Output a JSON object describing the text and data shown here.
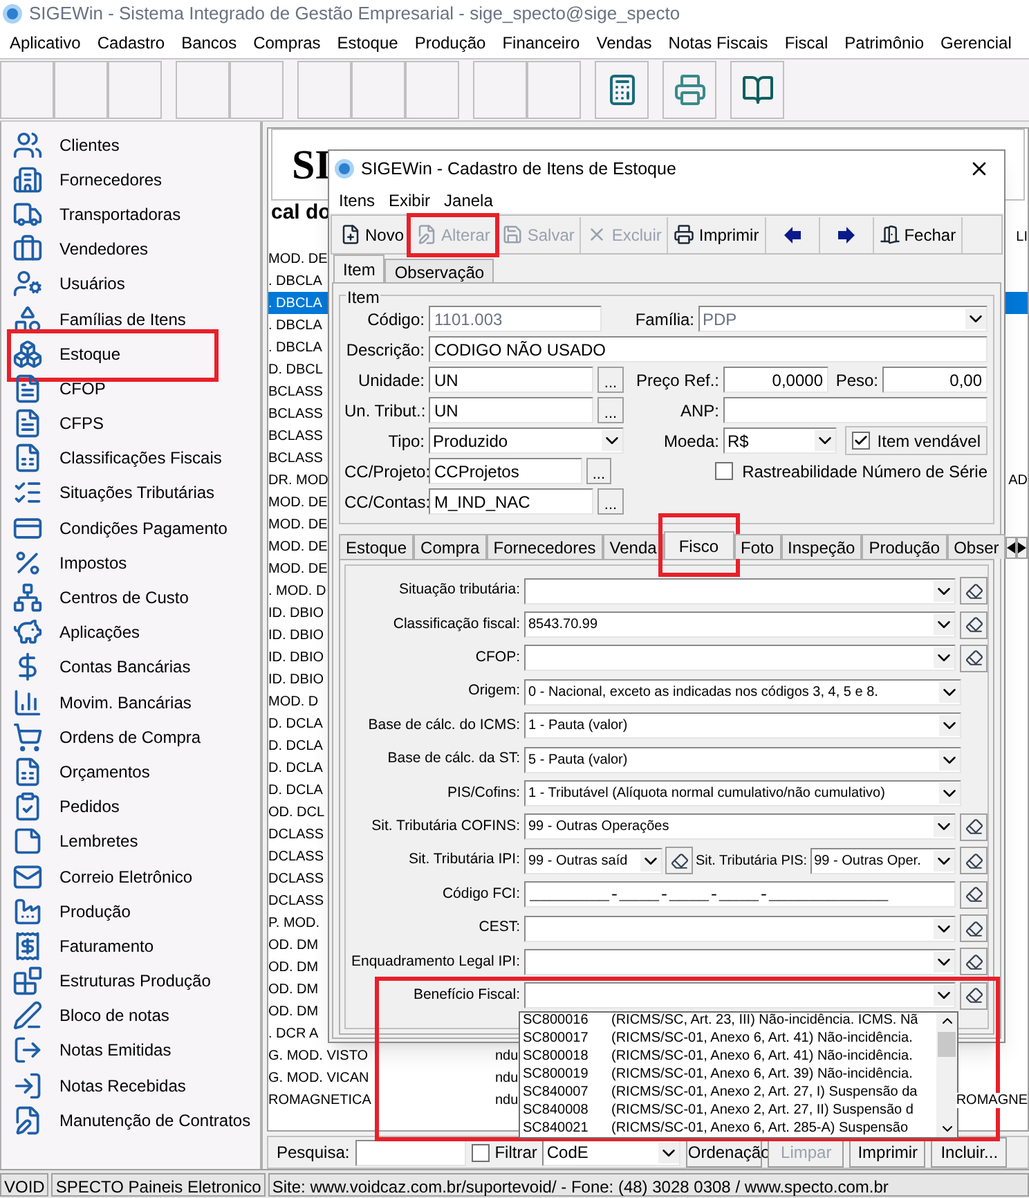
{
  "window": {
    "title": "SIGEWin - Sistema Integrado de Gestão Empresarial - sige_specto@sige_specto"
  },
  "menu": [
    "Aplicativo",
    "Cadastro",
    "Bancos",
    "Compras",
    "Estoque",
    "Produção",
    "Financeiro",
    "Vendas",
    "Notas Fiscais",
    "Fiscal",
    "Patrimônio",
    "Gerencial"
  ],
  "toolbar_groups": [
    [
      {
        "kind": "blank"
      },
      {
        "kind": "blank"
      },
      {
        "kind": "blank"
      }
    ],
    [
      {
        "kind": "blank"
      },
      {
        "kind": "blank"
      }
    ],
    [
      {
        "kind": "blank"
      },
      {
        "kind": "blank"
      },
      {
        "kind": "blank"
      }
    ],
    [
      {
        "kind": "blank"
      },
      {
        "kind": "blank"
      }
    ],
    [
      {
        "kind": "calculator"
      }
    ],
    [
      {
        "kind": "printer"
      }
    ],
    [
      {
        "kind": "book"
      }
    ]
  ],
  "sidebar": {
    "items": [
      {
        "label": "Clientes",
        "highlighted": false
      },
      {
        "label": "Fornecedores",
        "highlighted": false
      },
      {
        "label": "Transportadoras",
        "highlighted": false
      },
      {
        "label": "Vendedores",
        "highlighted": false
      },
      {
        "label": "Usuários",
        "highlighted": false
      },
      {
        "label": "Famílias de Itens",
        "highlighted": false
      },
      {
        "label": "Estoque",
        "highlighted": true
      },
      {
        "label": "CFOP",
        "highlighted": false
      },
      {
        "label": "CFPS",
        "highlighted": false
      },
      {
        "label": "Classificações Fiscais",
        "highlighted": false
      },
      {
        "label": "Situações Tributárias",
        "highlighted": false
      },
      {
        "label": "Condições Pagamento",
        "highlighted": false
      },
      {
        "label": "Impostos",
        "highlighted": false
      },
      {
        "label": "Centros de Custo",
        "highlighted": false
      },
      {
        "label": "Aplicações",
        "highlighted": false
      },
      {
        "label": "Contas Bancárias",
        "highlighted": false
      },
      {
        "label": "Movim. Bancárias",
        "highlighted": false
      },
      {
        "label": "Ordens de Compra",
        "highlighted": false
      },
      {
        "label": "Orçamentos",
        "highlighted": false
      },
      {
        "label": "Pedidos",
        "highlighted": false
      },
      {
        "label": "Lembretes",
        "highlighted": false
      },
      {
        "label": "Correio Eletrônico",
        "highlighted": false
      },
      {
        "label": "Produção",
        "highlighted": false
      },
      {
        "label": "Faturamento",
        "highlighted": false
      },
      {
        "label": "Estruturas Produção",
        "highlighted": false
      },
      {
        "label": "Bloco de notas",
        "highlighted": false
      },
      {
        "label": "Notas Emitidas",
        "highlighted": false
      },
      {
        "label": "Notas Recebidas",
        "highlighted": false
      },
      {
        "label": "Manutenção de Contratos",
        "highlighted": false
      }
    ]
  },
  "list": {
    "banner": "SI",
    "heading": "cal do",
    "rows": [
      {
        "right": "LI",
        "selected": false
      },
      {
        "text": "MOD. DE",
        "selected": false
      },
      {
        "text": ". DBCLA",
        "selected": false
      },
      {
        "text": ". DBCLA",
        "selected": true
      },
      {
        "text": ". DBCLA",
        "selected": false
      },
      {
        "text": ". DBCLA",
        "selected": false
      },
      {
        "text": "D. DBCL",
        "selected": false
      },
      {
        "text": "BCLASS",
        "selected": false
      },
      {
        "text": "BCLASS",
        "selected": false
      },
      {
        "text": "BCLASS",
        "selected": false
      },
      {
        "text": "BCLASS",
        "selected": false
      },
      {
        "text": "DR. MOD",
        "right": "AD",
        "selected": false
      },
      {
        "text": "MOD. DE",
        "selected": false
      },
      {
        "text": "MOD. DE",
        "selected": false
      },
      {
        "text": "MOD. DE",
        "selected": false
      },
      {
        "text": "MOD. DE",
        "selected": false
      },
      {
        "text": ". MOD. D",
        "selected": false
      },
      {
        "text": "ID. DBIO",
        "selected": false
      },
      {
        "text": "ID. DBIO",
        "selected": false
      },
      {
        "text": "ID. DBIO",
        "selected": false
      },
      {
        "text": "ID. DBIO",
        "selected": false
      },
      {
        "text": "MOD. D",
        "selected": false
      },
      {
        "text": "D. DCLA",
        "selected": false
      },
      {
        "text": "D. DCLA",
        "selected": false
      },
      {
        "text": "D. DCLA",
        "selected": false
      },
      {
        "text": "D. DCLA",
        "selected": false
      },
      {
        "text": "OD. DCL",
        "selected": false
      },
      {
        "text": "DCLASS",
        "selected": false
      },
      {
        "text": "DCLASS",
        "selected": false
      },
      {
        "text": "DCLASS",
        "selected": false
      },
      {
        "text": "DCLASS",
        "selected": false
      },
      {
        "text": "P. MOD.",
        "selected": false
      },
      {
        "text": "OD. DM",
        "selected": false
      },
      {
        "text": "OD. DM",
        "selected": false
      },
      {
        "text": "OD. DM",
        "selected": false
      },
      {
        "text": "OD. DM",
        "selected": false
      },
      {
        "text": ". DCR A",
        "selected": false
      },
      {
        "text": "G. MOD. VISTO",
        "middle": "ndu",
        "selected": false
      },
      {
        "text": "G. MOD. VICAN",
        "middle": "ndu",
        "selected": false
      },
      {
        "text": "ROMAGNETICA",
        "middle": "ndu",
        "right": "ROMAGNE",
        "selected": false
      }
    ]
  },
  "search_bar": {
    "label": "Pesquisa:",
    "filter": {
      "label": "Filtrar",
      "checked": false
    },
    "order_field": "CodE",
    "buttons": [
      {
        "label": "Ordenação",
        "disabled": false
      },
      {
        "label": "Limpar",
        "disabled": true
      },
      {
        "label": "Imprimir",
        "disabled": false
      },
      {
        "label": "Incluir...",
        "disabled": false
      }
    ]
  },
  "status_bar": [
    "VOID",
    "SPECTO Paineis Eletronico",
    "Site: www.voidcaz.com.br/suportevoid/  -  Fone: (48) 3028 0308 / www.specto.com.br"
  ],
  "dialog": {
    "title": "SIGEWin - Cadastro de Itens de Estoque",
    "menu": [
      "Itens",
      "Exibir",
      "Janela"
    ],
    "toolbar": [
      {
        "kind": "new",
        "label": "Novo",
        "disabled": false,
        "highlighted": false
      },
      {
        "kind": "edit",
        "label": "Alterar",
        "disabled": true,
        "highlighted": true
      },
      {
        "kind": "save",
        "label": "Salvar",
        "disabled": true,
        "highlighted": false
      },
      {
        "kind": "delete",
        "label": "Excluir",
        "disabled": true,
        "highlighted": false
      },
      {
        "kind": "print",
        "label": "Imprimir",
        "disabled": false,
        "highlighted": false
      },
      {
        "kind": "prev",
        "disabled": false,
        "highlighted": false
      },
      {
        "kind": "next",
        "disabled": false,
        "highlighted": false
      },
      {
        "kind": "close",
        "label": "Fechar",
        "disabled": false,
        "highlighted": false
      }
    ],
    "tabs": [
      {
        "label": "Item",
        "selected": true
      },
      {
        "label": "Observação",
        "selected": false
      }
    ],
    "item_group": {
      "title": "Item",
      "codigo": {
        "label": "Código:",
        "value": "1101.003",
        "disabled": true
      },
      "familia": {
        "label": "Família:",
        "value": "PDP",
        "disabled": true
      },
      "descricao": {
        "label": "Descrição:",
        "value": "CODIGO NÃO USADO"
      },
      "unidade": {
        "label": "Unidade:",
        "value": "UN"
      },
      "preco": {
        "label": "Preço Ref.:",
        "value": "0,0000"
      },
      "peso": {
        "label": "Peso:",
        "value": "0,00"
      },
      "un_tribut": {
        "label": "Un. Tribut.:",
        "value": "UN"
      },
      "anp": {
        "label": "ANP:"
      },
      "tipo": {
        "label": "Tipo:",
        "value": "Produzido"
      },
      "moeda": {
        "label": "Moeda:",
        "value": "R$"
      },
      "vendavel": {
        "label": "Item vendável",
        "checked": true
      },
      "cc_projeto": {
        "label": "CC/Projeto:",
        "value": "CCProjetos"
      },
      "rastreabilidade": {
        "label": "Rastreabilidade Número de Série",
        "checked": false
      },
      "cc_contas": {
        "label": "CC/Contas:",
        "value": "M_IND_NAC"
      },
      "browse": "..."
    },
    "detail_tabs": [
      {
        "label": "Estoque",
        "selected": false,
        "highlighted": false
      },
      {
        "label": "Compra",
        "selected": false,
        "highlighted": false
      },
      {
        "label": "Fornecedores",
        "selected": false,
        "highlighted": false
      },
      {
        "label": "Venda",
        "selected": false,
        "highlighted": false
      },
      {
        "label": "Fisco",
        "selected": true,
        "highlighted": true
      },
      {
        "label": "Foto",
        "selected": false,
        "highlighted": false
      },
      {
        "label": "Inspeção",
        "selected": false,
        "highlighted": false
      },
      {
        "label": "Produção",
        "selected": false,
        "highlighted": false
      },
      {
        "label": "Obser",
        "selected": false,
        "highlighted": false
      }
    ],
    "fisco": {
      "rows": [
        {
          "kind": "combo",
          "label": "Situação tributária:",
          "clear_button": true,
          "highlighted": false
        },
        {
          "kind": "combo",
          "label": "Classificação fiscal:",
          "value": "8543.70.99",
          "clear_button": true,
          "highlighted": false
        },
        {
          "kind": "combo",
          "label": "CFOP:",
          "clear_button": true,
          "highlighted": false
        },
        {
          "kind": "combo",
          "label": "Origem:",
          "value": "0 - Nacional, exceto as indicadas nos códigos 3, 4, 5 e 8.",
          "clear_button": false,
          "highlighted": false
        },
        {
          "kind": "combo",
          "label": "Base de cálc. do ICMS:",
          "value": "1 - Pauta (valor)",
          "clear_button": false,
          "highlighted": false
        },
        {
          "kind": "combo",
          "label": "Base de cálc. da ST:",
          "value": "5 - Pauta (valor)",
          "clear_button": false,
          "highlighted": false
        },
        {
          "kind": "combo",
          "label": "PIS/Cofins:",
          "value": "1 - Tributável (Alíquota normal  cumulativo/não cumulativo)",
          "clear_button": false,
          "highlighted": false
        },
        {
          "kind": "combo",
          "label": "Sit. Tributária COFINS:",
          "value": "99 - Outras Operações",
          "clear_button": true,
          "highlighted": false
        },
        {
          "kind": "split",
          "label": "Sit. Tributária IPI:",
          "value": "99 - Outras saíd",
          "second_label": "Sit. Tributária PIS:",
          "second_value": "99 - Outras Oper.",
          "clear_button": true,
          "highlighted": false
        },
        {
          "kind": "mask",
          "label": "Código FCI:",
          "value": "________-____-____-____-____________",
          "clear_button": true,
          "highlighted": false
        },
        {
          "kind": "combo",
          "label": "CEST:",
          "clear_button": true,
          "highlighted": false
        },
        {
          "kind": "combo",
          "label": "Enquadramento Legal IPI:",
          "clear_button": true,
          "highlighted": false
        },
        {
          "kind": "combo",
          "label": "Benefício Fiscal:",
          "clear_button": true,
          "highlighted": true
        }
      ]
    },
    "dropdown": {
      "options": [
        {
          "code": "SC800016",
          "description": "(RICMS/SC, Art. 23, III) Não-incidência. ICMS. Nã"
        },
        {
          "code": "SC800017",
          "description": "(RICMS/SC-01, Anexo 6, Art. 41) Não-incidência."
        },
        {
          "code": "SC800018",
          "description": "(RICMS/SC-01, Anexo 6, Art. 41) Não-incidência."
        },
        {
          "code": "SC800019",
          "description": "(RICMS/SC-01, Anexo 6, Art. 39) Não-incidência."
        },
        {
          "code": "SC840007",
          "description": "(RICMS/SC-01, Anexo 2, Art. 27, I) Suspensão da"
        },
        {
          "code": "SC840008",
          "description": "(RICMS/SC-01, Anexo 2, Art. 27, II) Suspensão d"
        },
        {
          "code": "SC840021",
          "description": "(RICMS/SC-01, Anexo 6, Art. 285-A) Suspensão"
        }
      ]
    }
  }
}
